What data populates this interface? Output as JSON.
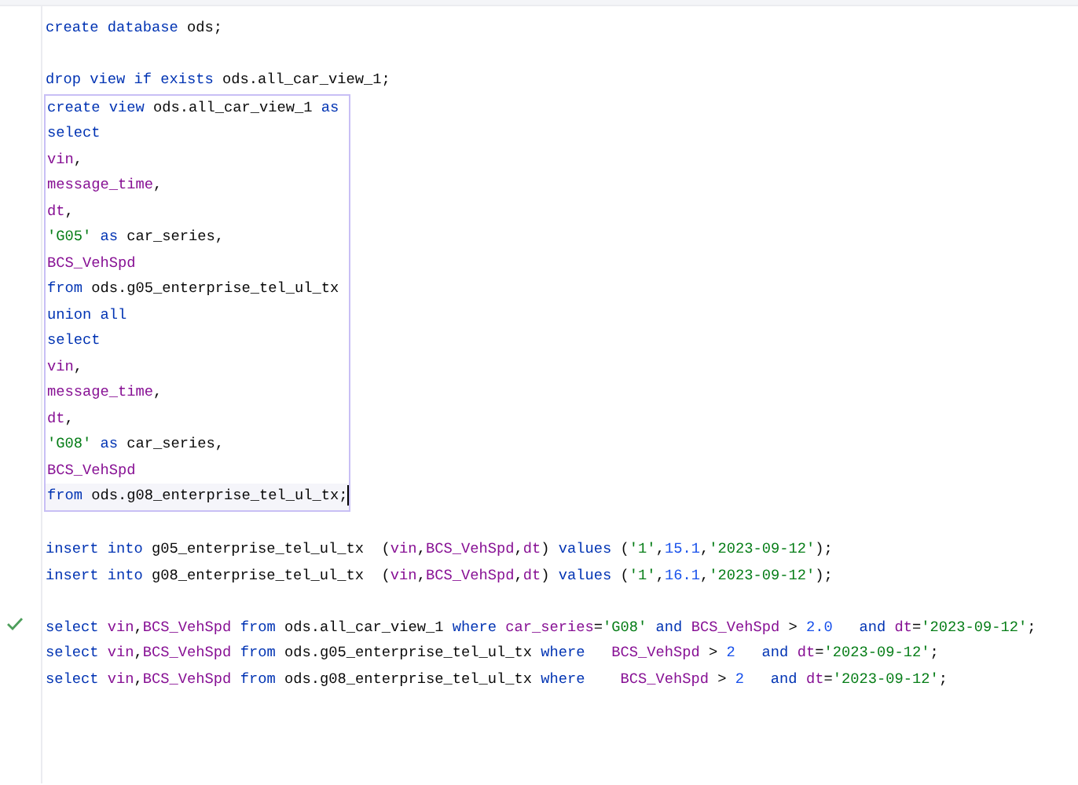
{
  "editor": {
    "lines": [
      {
        "kind": "code",
        "tokens": [
          {
            "text": "create database ",
            "kind": "kw"
          },
          {
            "text": "ods;",
            "kind": "p"
          }
        ]
      },
      {
        "kind": "blank"
      },
      {
        "kind": "code",
        "tokens": [
          {
            "text": "drop view if exists ",
            "kind": "kw"
          },
          {
            "text": "ods.all_car_view_1;",
            "kind": "p"
          }
        ]
      },
      {
        "kind": "block",
        "outlined": true,
        "lines": [
          {
            "kind": "code",
            "tokens": [
              {
                "text": "create view ",
                "kind": "kw"
              },
              {
                "text": "ods.all_car_view_1 ",
                "kind": "p"
              },
              {
                "text": "as",
                "kind": "kw"
              }
            ]
          },
          {
            "kind": "code",
            "tokens": [
              {
                "text": "select",
                "kind": "kw"
              }
            ]
          },
          {
            "kind": "code",
            "tokens": [
              {
                "text": "vin",
                "kind": "id"
              },
              {
                "text": ",",
                "kind": "p"
              }
            ]
          },
          {
            "kind": "code",
            "tokens": [
              {
                "text": "message_time",
                "kind": "id"
              },
              {
                "text": ",",
                "kind": "p"
              }
            ]
          },
          {
            "kind": "code",
            "tokens": [
              {
                "text": "dt",
                "kind": "id"
              },
              {
                "text": ",",
                "kind": "p"
              }
            ]
          },
          {
            "kind": "code",
            "tokens": [
              {
                "text": "'G05'",
                "kind": "str"
              },
              {
                "text": " as ",
                "kind": "kw"
              },
              {
                "text": "car_series,",
                "kind": "p"
              }
            ]
          },
          {
            "kind": "code",
            "tokens": [
              {
                "text": "BCS_VehSpd",
                "kind": "id"
              }
            ]
          },
          {
            "kind": "code",
            "tokens": [
              {
                "text": "from ",
                "kind": "kw"
              },
              {
                "text": "ods.g05_enterprise_tel_ul_tx",
                "kind": "p"
              }
            ]
          },
          {
            "kind": "code",
            "tokens": [
              {
                "text": "union all",
                "kind": "kw"
              }
            ]
          },
          {
            "kind": "code",
            "tokens": [
              {
                "text": "select",
                "kind": "kw"
              }
            ]
          },
          {
            "kind": "code",
            "tokens": [
              {
                "text": "vin",
                "kind": "id"
              },
              {
                "text": ",",
                "kind": "p"
              }
            ]
          },
          {
            "kind": "code",
            "tokens": [
              {
                "text": "message_time",
                "kind": "id"
              },
              {
                "text": ",",
                "kind": "p"
              }
            ]
          },
          {
            "kind": "code",
            "tokens": [
              {
                "text": "dt",
                "kind": "id"
              },
              {
                "text": ",",
                "kind": "p"
              }
            ]
          },
          {
            "kind": "code",
            "tokens": [
              {
                "text": "'G08'",
                "kind": "str"
              },
              {
                "text": " as ",
                "kind": "kw"
              },
              {
                "text": "car_series,",
                "kind": "p"
              }
            ]
          },
          {
            "kind": "code",
            "tokens": [
              {
                "text": "BCS_VehSpd",
                "kind": "id"
              }
            ]
          },
          {
            "kind": "code",
            "current": true,
            "caret": true,
            "tokens": [
              {
                "text": "from ",
                "kind": "kw"
              },
              {
                "text": "ods.g08_enterprise_tel_ul_tx;",
                "kind": "p"
              }
            ]
          }
        ]
      },
      {
        "kind": "blank"
      },
      {
        "kind": "code",
        "tokens": [
          {
            "text": "insert into ",
            "kind": "kw"
          },
          {
            "text": "g05_enterprise_tel_ul_tx  (",
            "kind": "p"
          },
          {
            "text": "vin",
            "kind": "id"
          },
          {
            "text": ",",
            "kind": "p"
          },
          {
            "text": "BCS_VehSpd",
            "kind": "id"
          },
          {
            "text": ",",
            "kind": "p"
          },
          {
            "text": "dt",
            "kind": "id"
          },
          {
            "text": ") ",
            "kind": "p"
          },
          {
            "text": "values ",
            "kind": "kw"
          },
          {
            "text": "(",
            "kind": "p"
          },
          {
            "text": "'1'",
            "kind": "str"
          },
          {
            "text": ",",
            "kind": "p"
          },
          {
            "text": "15.1",
            "kind": "num"
          },
          {
            "text": ",",
            "kind": "p"
          },
          {
            "text": "'2023-09-12'",
            "kind": "str"
          },
          {
            "text": ");",
            "kind": "p"
          }
        ]
      },
      {
        "kind": "code",
        "tokens": [
          {
            "text": "insert into ",
            "kind": "kw"
          },
          {
            "text": "g08_enterprise_tel_ul_tx  (",
            "kind": "p"
          },
          {
            "text": "vin",
            "kind": "id"
          },
          {
            "text": ",",
            "kind": "p"
          },
          {
            "text": "BCS_VehSpd",
            "kind": "id"
          },
          {
            "text": ",",
            "kind": "p"
          },
          {
            "text": "dt",
            "kind": "id"
          },
          {
            "text": ") ",
            "kind": "p"
          },
          {
            "text": "values ",
            "kind": "kw"
          },
          {
            "text": "(",
            "kind": "p"
          },
          {
            "text": "'1'",
            "kind": "str"
          },
          {
            "text": ",",
            "kind": "p"
          },
          {
            "text": "16.1",
            "kind": "num"
          },
          {
            "text": ",",
            "kind": "p"
          },
          {
            "text": "'2023-09-12'",
            "kind": "str"
          },
          {
            "text": ");",
            "kind": "p"
          }
        ]
      },
      {
        "kind": "blank"
      },
      {
        "kind": "code",
        "passed": true,
        "tokens": [
          {
            "text": "select ",
            "kind": "kw"
          },
          {
            "text": "vin",
            "kind": "id"
          },
          {
            "text": ",",
            "kind": "p"
          },
          {
            "text": "BCS_VehSpd",
            "kind": "id"
          },
          {
            "text": " from ",
            "kind": "kw"
          },
          {
            "text": "ods.all_car_view_1 ",
            "kind": "p"
          },
          {
            "text": "where ",
            "kind": "kw"
          },
          {
            "text": "car_series",
            "kind": "id"
          },
          {
            "text": "=",
            "kind": "p"
          },
          {
            "text": "'G08'",
            "kind": "str"
          },
          {
            "text": " and ",
            "kind": "kw"
          },
          {
            "text": "BCS_VehSpd",
            "kind": "id"
          },
          {
            "text": " > ",
            "kind": "p"
          },
          {
            "text": "2.0",
            "kind": "num"
          },
          {
            "text": "   and ",
            "kind": "kw"
          },
          {
            "text": "dt",
            "kind": "id"
          },
          {
            "text": "=",
            "kind": "p"
          },
          {
            "text": "'2023-09-12'",
            "kind": "str"
          },
          {
            "text": ";",
            "kind": "p"
          }
        ]
      },
      {
        "kind": "code",
        "tokens": [
          {
            "text": "select ",
            "kind": "kw"
          },
          {
            "text": "vin",
            "kind": "id"
          },
          {
            "text": ",",
            "kind": "p"
          },
          {
            "text": "BCS_VehSpd",
            "kind": "id"
          },
          {
            "text": " from ",
            "kind": "kw"
          },
          {
            "text": "ods.g05_enterprise_tel_ul_tx ",
            "kind": "p"
          },
          {
            "text": "where   ",
            "kind": "kw"
          },
          {
            "text": "BCS_VehSpd",
            "kind": "id"
          },
          {
            "text": " > ",
            "kind": "p"
          },
          {
            "text": "2",
            "kind": "num"
          },
          {
            "text": "   and ",
            "kind": "kw"
          },
          {
            "text": "dt",
            "kind": "id"
          },
          {
            "text": "=",
            "kind": "p"
          },
          {
            "text": "'2023-09-12'",
            "kind": "str"
          },
          {
            "text": ";",
            "kind": "p"
          }
        ]
      },
      {
        "kind": "code",
        "tokens": [
          {
            "text": "select ",
            "kind": "kw"
          },
          {
            "text": "vin",
            "kind": "id"
          },
          {
            "text": ",",
            "kind": "p"
          },
          {
            "text": "BCS_VehSpd",
            "kind": "id"
          },
          {
            "text": " from ",
            "kind": "kw"
          },
          {
            "text": "ods.g08_enterprise_tel_ul_tx ",
            "kind": "p"
          },
          {
            "text": "where    ",
            "kind": "kw"
          },
          {
            "text": "BCS_VehSpd",
            "kind": "id"
          },
          {
            "text": " > ",
            "kind": "p"
          },
          {
            "text": "2",
            "kind": "num"
          },
          {
            "text": "   and ",
            "kind": "kw"
          },
          {
            "text": "dt",
            "kind": "id"
          },
          {
            "text": "=",
            "kind": "p"
          },
          {
            "text": "'2023-09-12'",
            "kind": "str"
          },
          {
            "text": ";",
            "kind": "p"
          }
        ]
      }
    ]
  }
}
